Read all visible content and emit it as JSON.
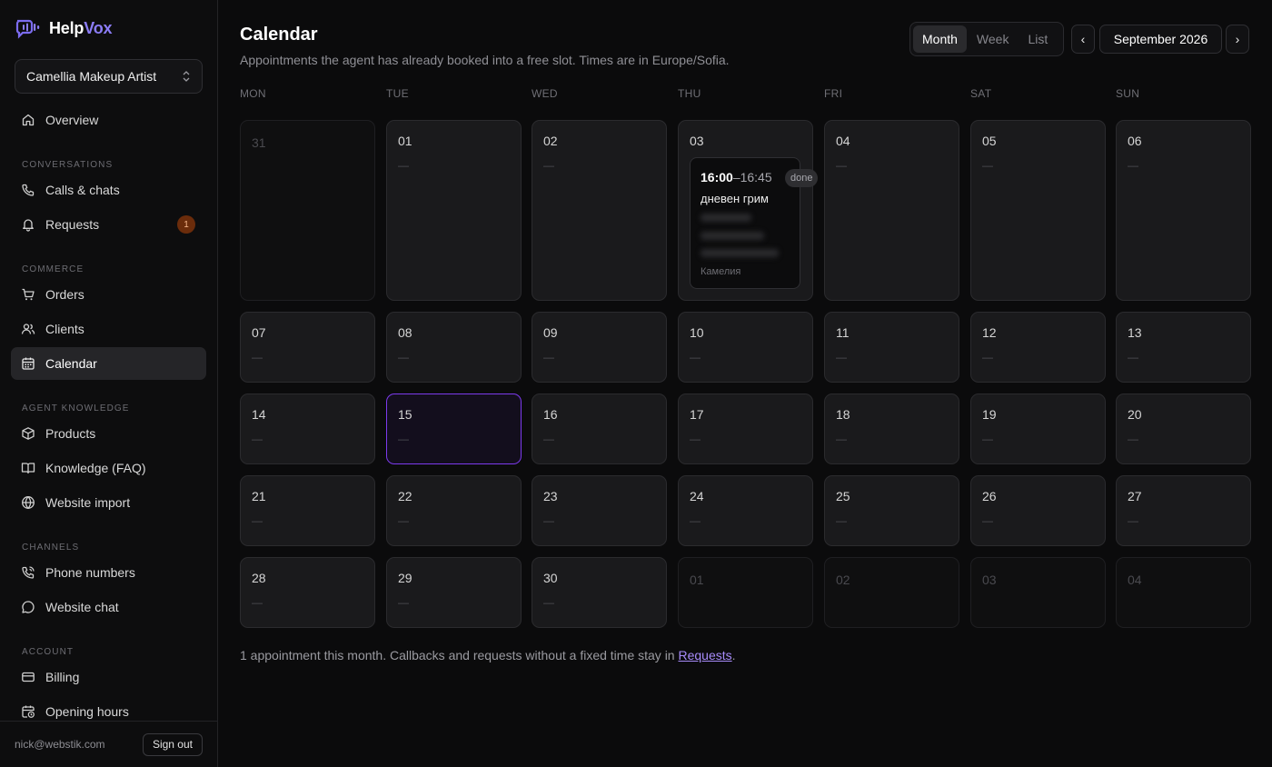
{
  "brand": {
    "name_part1": "Help",
    "name_part2": "Vox"
  },
  "business_selector": {
    "value": "Camellia Makeup Artist"
  },
  "nav": {
    "overview": "Overview",
    "section_conversations": "CONVERSATIONS",
    "calls_chats": "Calls & chats",
    "requests": "Requests",
    "requests_badge": "1",
    "section_commerce": "COMMERCE",
    "orders": "Orders",
    "clients": "Clients",
    "calendar": "Calendar",
    "section_knowledge": "AGENT KNOWLEDGE",
    "products": "Products",
    "knowledge_faq": "Knowledge (FAQ)",
    "website_import": "Website import",
    "section_channels": "CHANNELS",
    "phone_numbers": "Phone numbers",
    "website_chat": "Website chat",
    "section_account": "ACCOUNT",
    "billing": "Billing",
    "opening_hours": "Opening hours"
  },
  "footer": {
    "email": "nick@webstik.com",
    "sign_out": "Sign out"
  },
  "header": {
    "title": "Calendar",
    "subtitle": "Appointments the agent has already booked into a free slot. Times are in Europe/Sofia."
  },
  "view_toggle": {
    "month": "Month",
    "week": "Week",
    "list": "List"
  },
  "period": {
    "prev": "‹",
    "next": "›",
    "label": "September 2026"
  },
  "weekdays": [
    "MON",
    "TUE",
    "WED",
    "THU",
    "FRI",
    "SAT",
    "SUN"
  ],
  "days": [
    {
      "label": "31",
      "other": true
    },
    {
      "label": "01"
    },
    {
      "label": "02"
    },
    {
      "label": "03",
      "appt": true
    },
    {
      "label": "04"
    },
    {
      "label": "05"
    },
    {
      "label": "06"
    },
    {
      "label": "07"
    },
    {
      "label": "08"
    },
    {
      "label": "09"
    },
    {
      "label": "10"
    },
    {
      "label": "11"
    },
    {
      "label": "12"
    },
    {
      "label": "13"
    },
    {
      "label": "14"
    },
    {
      "label": "15",
      "today": true
    },
    {
      "label": "16"
    },
    {
      "label": "17"
    },
    {
      "label": "18"
    },
    {
      "label": "19"
    },
    {
      "label": "20"
    },
    {
      "label": "21"
    },
    {
      "label": "22"
    },
    {
      "label": "23"
    },
    {
      "label": "24"
    },
    {
      "label": "25"
    },
    {
      "label": "26"
    },
    {
      "label": "27"
    },
    {
      "label": "28"
    },
    {
      "label": "29"
    },
    {
      "label": "30"
    },
    {
      "label": "01",
      "other": true
    },
    {
      "label": "02",
      "other": true
    },
    {
      "label": "03",
      "other": true
    },
    {
      "label": "04",
      "other": true
    }
  ],
  "empty_marker": "—",
  "appointment": {
    "start": "16:00",
    "end_part": "–16:45",
    "status": "done",
    "service": "дневен грим",
    "owner": "Камелия"
  },
  "footnote": {
    "text": "1 appointment this month. Callbacks and requests without a fixed time stay in ",
    "link": "Requests",
    "end": "."
  },
  "colors": {
    "accent": "#8b7cf6",
    "today_border": "#7c3aed",
    "badge": "#6b2c0b",
    "link": "#a78bfa"
  }
}
